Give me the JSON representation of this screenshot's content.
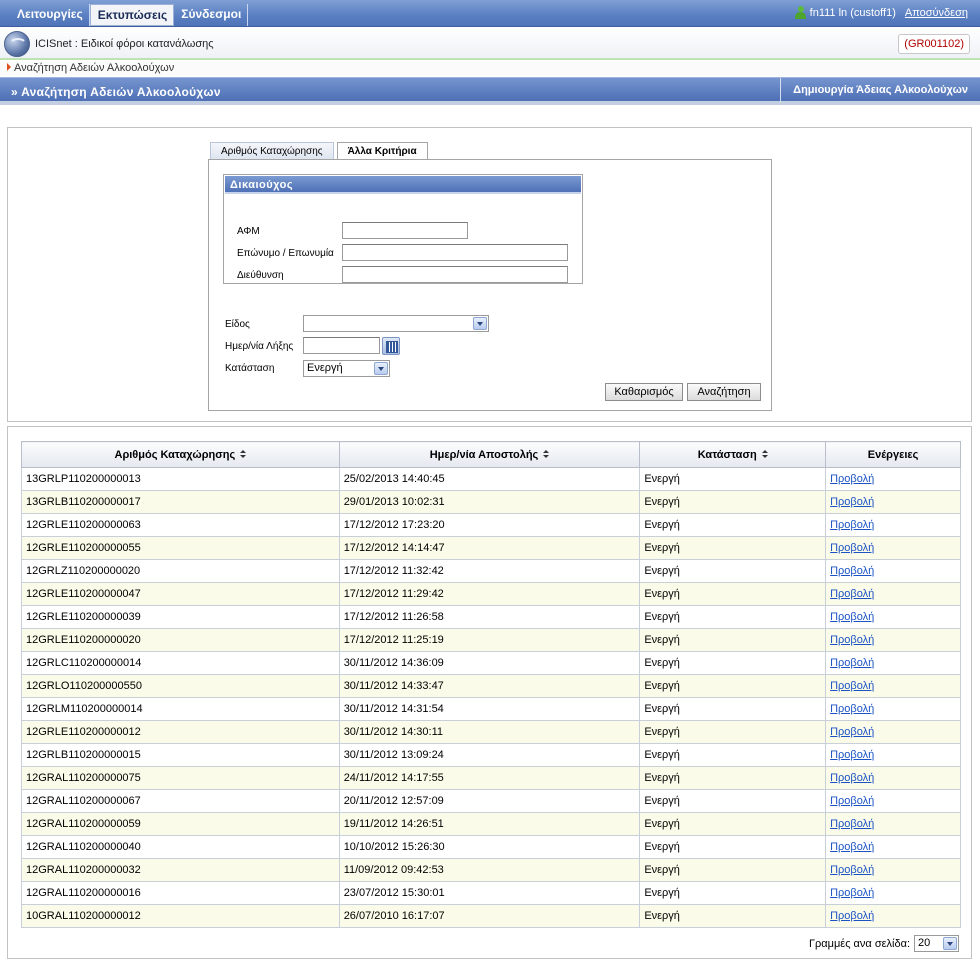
{
  "menu": {
    "items": [
      {
        "label": "Λειτουργίες",
        "active": false
      },
      {
        "label": "Εκτυπώσεις",
        "active": true
      },
      {
        "label": "Σύνδεσμοι",
        "active": false
      }
    ],
    "user": "fn111 ln (custoff1)",
    "logout": "Αποσύνδεση"
  },
  "app": {
    "title": "ICISnet : Ειδικοί φόροι κατανάλωσης",
    "code": "(GR001102)"
  },
  "breadcrumb": "Αναζήτηση Αδειών Αλκοολούχων",
  "page": {
    "title": "» Αναζήτηση Αδειών Αλκοολούχων",
    "create_label": "Δημιουργία Άδειας Αλκοολούχων"
  },
  "search": {
    "tabs": [
      {
        "label": "Αριθμός Καταχώρησης",
        "active": false
      },
      {
        "label": "Άλλα Κριτήρια",
        "active": true
      }
    ],
    "beneficiary_legend": "Δικαιούχος",
    "afm_label": "ΑΦΜ",
    "afm_value": "",
    "name_label": "Επώνυμο / Επωνυμία",
    "name_value": "",
    "address_label": "Διεύθυνση",
    "address_value": "",
    "type_label": "Είδος",
    "type_value": "",
    "expiry_label": "Ημερ/νία Λήξης",
    "expiry_value": "",
    "status_label": "Κατάσταση",
    "status_value": "Ενεργή",
    "clear_label": "Καθαρισμός",
    "search_label": "Αναζήτηση"
  },
  "results": {
    "columns": [
      "Αριθμός Καταχώρησης",
      "Ημερ/νία Αποστολής",
      "Κατάσταση",
      "Ενέργειες"
    ],
    "action_label": "Προβολή",
    "rows": [
      [
        "13GRLP110200000013",
        "25/02/2013 14:40:45",
        "Ενεργή"
      ],
      [
        "13GRLB110200000017",
        "29/01/2013 10:02:31",
        "Ενεργή"
      ],
      [
        "12GRLE110200000063",
        "17/12/2012 17:23:20",
        "Ενεργή"
      ],
      [
        "12GRLE110200000055",
        "17/12/2012 14:14:47",
        "Ενεργή"
      ],
      [
        "12GRLZ110200000020",
        "17/12/2012 11:32:42",
        "Ενεργή"
      ],
      [
        "12GRLE110200000047",
        "17/12/2012 11:29:42",
        "Ενεργή"
      ],
      [
        "12GRLE110200000039",
        "17/12/2012 11:26:58",
        "Ενεργή"
      ],
      [
        "12GRLE110200000020",
        "17/12/2012 11:25:19",
        "Ενεργή"
      ],
      [
        "12GRLC110200000014",
        "30/11/2012 14:36:09",
        "Ενεργή"
      ],
      [
        "12GRLO110200000550",
        "30/11/2012 14:33:47",
        "Ενεργή"
      ],
      [
        "12GRLM110200000014",
        "30/11/2012 14:31:54",
        "Ενεργή"
      ],
      [
        "12GRLE110200000012",
        "30/11/2012 14:30:11",
        "Ενεργή"
      ],
      [
        "12GRLB110200000015",
        "30/11/2012 13:09:24",
        "Ενεργή"
      ],
      [
        "12GRAL110200000075",
        "24/11/2012 14:17:55",
        "Ενεργή"
      ],
      [
        "12GRAL110200000067",
        "20/11/2012 12:57:09",
        "Ενεργή"
      ],
      [
        "12GRAL110200000059",
        "19/11/2012 14:26:51",
        "Ενεργή"
      ],
      [
        "12GRAL110200000040",
        "10/10/2012 15:26:30",
        "Ενεργή"
      ],
      [
        "12GRAL110200000032",
        "11/09/2012 09:42:53",
        "Ενεργή"
      ],
      [
        "12GRAL110200000016",
        "23/07/2012 15:30:01",
        "Ενεργή"
      ],
      [
        "10GRAL110200000012",
        "26/07/2010 16:17:07",
        "Ενεργή"
      ]
    ],
    "rows_per_page_label": "Γραμμές ανα σελίδα:",
    "rows_per_page_value": "20"
  }
}
